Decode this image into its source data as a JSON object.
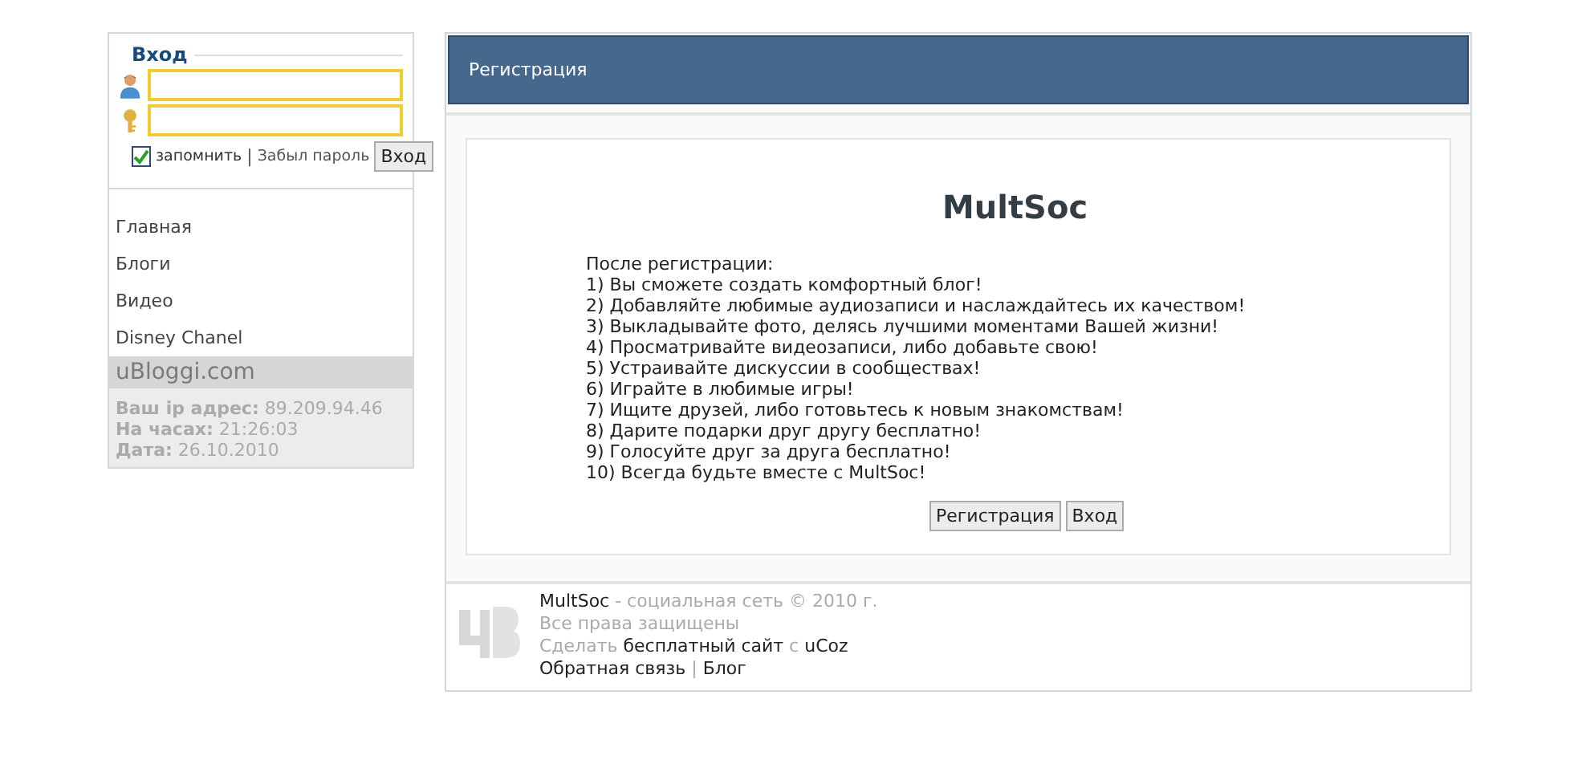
{
  "login": {
    "title": "Вход",
    "remember": {
      "label": "запомнить",
      "checked": true
    },
    "sep": "|",
    "forgot": "Забыл пароль",
    "button": "Вход"
  },
  "menu": [
    {
      "label": "Главная"
    },
    {
      "label": "Блоги"
    },
    {
      "label": "Видео"
    },
    {
      "label": "Disney Chanel"
    }
  ],
  "site_name": "uBloggi.com",
  "info": [
    {
      "label": "Ваш ip адрес:",
      "value": "89.209.94.46"
    },
    {
      "label": "На часах:",
      "value": "21:26:03"
    },
    {
      "label": "Дата:",
      "value": "26.10.2010"
    }
  ],
  "panel": {
    "title": "Регистрация"
  },
  "content": {
    "heading": "MultSoc",
    "lines": [
      "После регистрации:",
      "1) Вы сможете создать комфортный блог!",
      "2) Добавляйте любимые аудиозаписи и наслаждайтесь их качеством!",
      "3) Выкладывайте фото, делясь лучшими моментами Вашей жизни!",
      "4) Просматривайте видеозаписи, либо добавьте свою!",
      "5) Устраивайте дискуссии в сообществах!",
      "6) Играйте в любимые игры!",
      "7) Ищите друзей, либо готовьтесь к новым знакомствам!",
      "8) Дарите подарки друг другу бесплатно!",
      "9) Голосуйте друг за друга бесплатно!",
      "10) Всегда будьте вместе с MultSoc!"
    ],
    "buttons": [
      "Регистрация",
      "Вход"
    ]
  },
  "footer": {
    "site": "MultSoc",
    "tagline": "- социальная сеть © 2010 г.",
    "rights": "Все права защищены",
    "make": "Сделать",
    "free_site": "бесплатный сайт",
    "with": "с",
    "ucoz": "uCoz",
    "feedback": "Обратная связь",
    "sep": "|",
    "blog": "Блог"
  }
}
